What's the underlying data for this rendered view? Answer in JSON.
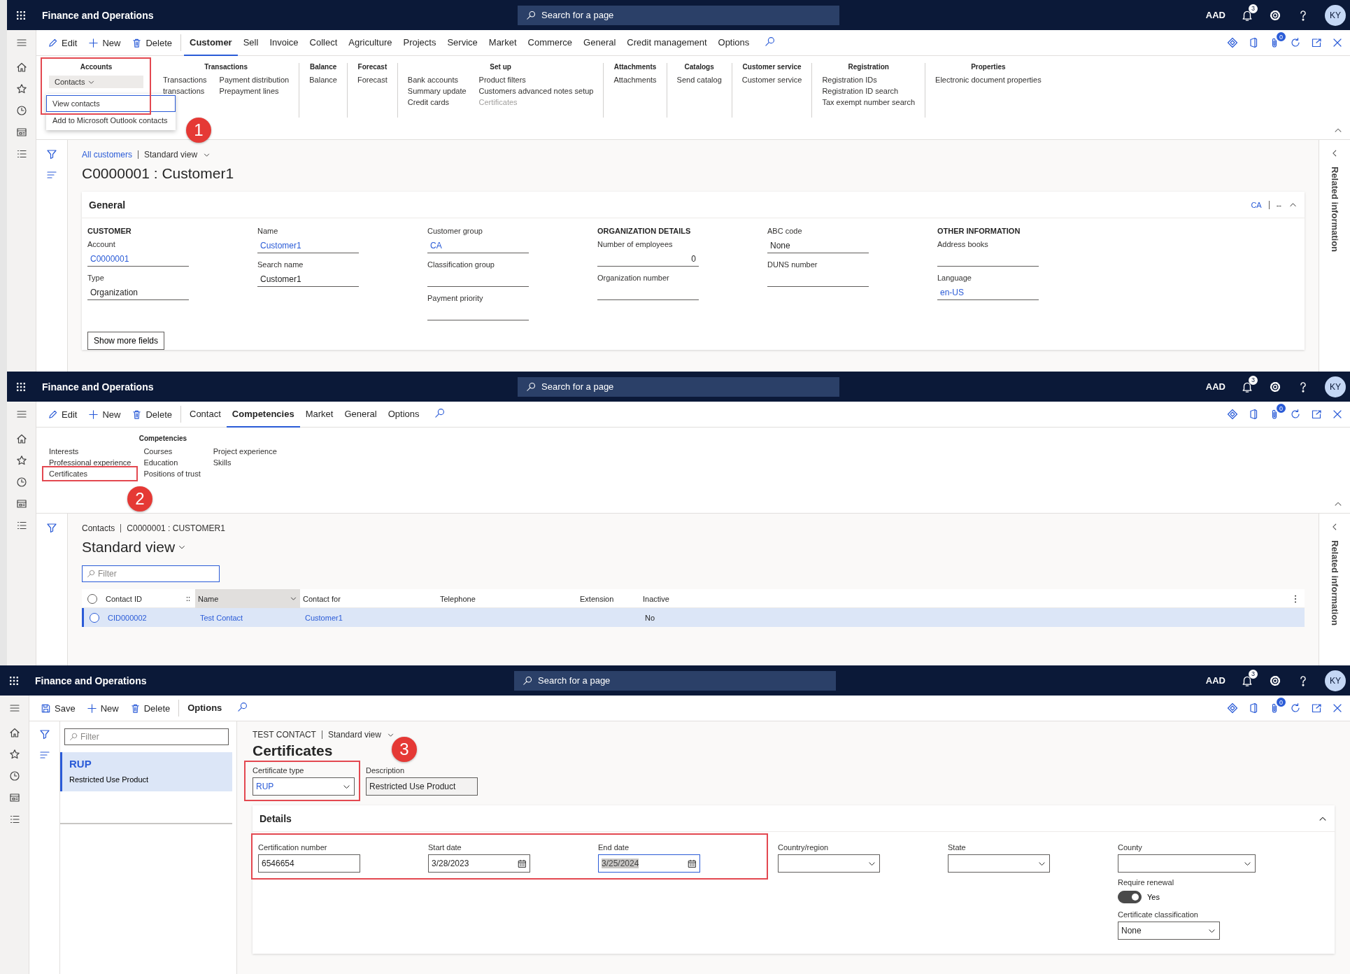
{
  "panels": [
    {
      "kind": "customer_form",
      "callout": "1",
      "header": {
        "app_title": "Finance and Operations",
        "search_placeholder": "Search for a page",
        "company": "AAD",
        "notifications": "3",
        "avatar": "KY"
      },
      "actions": [
        {
          "kind": "edit",
          "label": "Edit"
        },
        {
          "kind": "new",
          "label": "New"
        },
        {
          "kind": "delete",
          "label": "Delete"
        }
      ],
      "tabs": [
        {
          "label": "Customer",
          "selected": true
        },
        {
          "label": "Sell",
          "selected": false
        },
        {
          "label": "Invoice",
          "selected": false
        },
        {
          "label": "Collect",
          "selected": false
        },
        {
          "label": "Agriculture",
          "selected": false
        },
        {
          "label": "Projects",
          "selected": false
        },
        {
          "label": "Service",
          "selected": false
        },
        {
          "label": "Market",
          "selected": false
        },
        {
          "label": "Commerce",
          "selected": false
        },
        {
          "label": "General",
          "selected": false
        },
        {
          "label": "Credit management",
          "selected": false
        },
        {
          "label": "Options",
          "selected": false
        }
      ],
      "attachments_count": "0",
      "ribbon": [
        {
          "title": "Accounts",
          "highlighted": true,
          "dropdown": {
            "label": "Contacts",
            "expanded": true,
            "items": [
              {
                "label": "View contacts",
                "selected": true
              },
              {
                "label": "Add to Microsoft Outlook contacts",
                "selected": false
              }
            ]
          }
        },
        {
          "title": "Transactions",
          "columns": [
            [
              {
                "label": "Transactions",
                "disabled": false
              },
              {
                "label": "transactions",
                "disabled": false
              }
            ],
            [
              {
                "label": "Payment distribution",
                "disabled": false
              },
              {
                "label": "Prepayment lines",
                "disabled": false
              }
            ]
          ]
        },
        {
          "title": "Balance",
          "columns": [
            [
              {
                "label": "Balance",
                "disabled": false
              }
            ]
          ]
        },
        {
          "title": "Forecast",
          "columns": [
            [
              {
                "label": "Forecast",
                "disabled": false
              }
            ]
          ]
        },
        {
          "title": "Set up",
          "columns": [
            [
              {
                "label": "Bank accounts",
                "disabled": false
              },
              {
                "label": "Summary update",
                "disabled": false
              },
              {
                "label": "Credit cards",
                "disabled": false
              }
            ],
            [
              {
                "label": "Product filters",
                "disabled": false
              },
              {
                "label": "Customers advanced notes setup",
                "disabled": false
              },
              {
                "label": "Certificates",
                "disabled": true
              }
            ]
          ]
        },
        {
          "title": "Attachments",
          "columns": [
            [
              {
                "label": "Attachments",
                "disabled": false
              }
            ]
          ]
        },
        {
          "title": "Catalogs",
          "columns": [
            [
              {
                "label": "Send catalog",
                "disabled": false
              }
            ]
          ]
        },
        {
          "title": "Customer service",
          "columns": [
            [
              {
                "label": "Customer service",
                "disabled": false
              }
            ]
          ]
        },
        {
          "title": "Registration",
          "columns": [
            [
              {
                "label": "Registration IDs",
                "disabled": false
              },
              {
                "label": "Registration ID search",
                "disabled": false
              },
              {
                "label": "Tax exempt number search",
                "disabled": false
              }
            ]
          ]
        },
        {
          "title": "Properties",
          "columns": [
            [
              {
                "label": "Electronic document properties",
                "disabled": false
              }
            ]
          ]
        }
      ],
      "breadcrumb": [
        {
          "text": "All customers",
          "link": true
        },
        {
          "text": "Standard view",
          "link": false
        }
      ],
      "title": "C0000001 : Customer1",
      "card": {
        "title": "General",
        "header_items": [
          "CA",
          "--"
        ],
        "expanded": true,
        "columns": [
          [
            {
              "kind": "heading",
              "text": "CUSTOMER"
            },
            {
              "kind": "field",
              "label": "Account",
              "value": "C0000001",
              "link": true
            },
            {
              "kind": "field",
              "label": "Type",
              "value": "Organization",
              "link": false
            }
          ],
          [
            {
              "kind": "field",
              "label": "Name",
              "value": "Customer1",
              "link": true
            },
            {
              "kind": "field",
              "label": "Search name",
              "value": "Customer1",
              "link": false
            }
          ],
          [
            {
              "kind": "field",
              "label": "Customer group",
              "value": "CA",
              "link": true
            },
            {
              "kind": "field",
              "label": "Classification group"
            },
            {
              "kind": "field",
              "label": "Payment priority"
            }
          ],
          [
            {
              "kind": "heading",
              "text": "ORGANIZATION DETAILS"
            },
            {
              "kind": "number",
              "label": "Number of employees",
              "value": "0",
              "link": false
            },
            {
              "kind": "field",
              "label": "Organization number"
            }
          ],
          [
            {
              "kind": "field",
              "label": "ABC code",
              "value": "None",
              "link": false
            },
            {
              "kind": "field",
              "label": "DUNS number"
            }
          ],
          [
            {
              "kind": "heading",
              "text": "OTHER INFORMATION"
            },
            {
              "kind": "field",
              "label": "Address books"
            },
            {
              "kind": "field",
              "label": "Language",
              "value": "en-US",
              "link": true
            }
          ]
        ],
        "button": "Show more fields"
      },
      "related": "Related information"
    },
    {
      "kind": "contacts_list",
      "callout": "2",
      "header": {
        "app_title": "Finance and Operations",
        "search_placeholder": "Search for a page",
        "company": "AAD",
        "notifications": "3",
        "avatar": "KY"
      },
      "actions": [
        {
          "kind": "edit",
          "label": "Edit"
        },
        {
          "kind": "new",
          "label": "New"
        },
        {
          "kind": "delete",
          "label": "Delete"
        }
      ],
      "tabs": [
        {
          "label": "Contact",
          "selected": false
        },
        {
          "label": "Competencies",
          "selected": true
        },
        {
          "label": "Market",
          "selected": false
        },
        {
          "label": "General",
          "selected": false
        },
        {
          "label": "Options",
          "selected": false
        }
      ],
      "attachments_count": "0",
      "ribbon": [
        {
          "title": "Competencies",
          "columns": [
            [
              {
                "label": "Interests"
              },
              {
                "label": "Professional experience"
              },
              {
                "label": "Certificates",
                "highlighted": true
              }
            ],
            [
              {
                "label": "Courses"
              },
              {
                "label": "Education"
              },
              {
                "label": "Positions of trust"
              }
            ],
            [
              {
                "label": "Project experience"
              },
              {
                "label": "Skills"
              }
            ]
          ]
        }
      ],
      "breadcrumb": [
        {
          "text": "Contacts",
          "link": false
        },
        {
          "text": "C0000001 : CUSTOMER1",
          "link": false
        }
      ],
      "title": "Standard view",
      "filter_placeholder": "Filter",
      "grid": {
        "all_selected": false,
        "columns": [
          "Contact ID",
          "Name",
          "Contact for",
          "Telephone",
          "Extension",
          "Inactive"
        ],
        "rows": [
          {
            "selected": true,
            "cells": [
              {
                "text": "CID000002",
                "link": true
              },
              {
                "text": "Test Contact",
                "link": true
              },
              {
                "text": "Customer1",
                "link": true
              },
              {},
              {},
              {
                "text": "No",
                "link": false
              }
            ]
          }
        ]
      },
      "related": "Related information"
    },
    {
      "kind": "certificates_form",
      "callout": "3",
      "header": {
        "app_title": "Finance and Operations",
        "search_placeholder": "Search for a page",
        "company": "AAD",
        "notifications": "3",
        "avatar": "KY"
      },
      "actions": [
        {
          "kind": "save",
          "label": "Save"
        },
        {
          "kind": "new",
          "label": "New"
        },
        {
          "kind": "delete",
          "label": "Delete"
        }
      ],
      "tabs": [
        {
          "label": "Options",
          "selected": false
        }
      ],
      "attachments_count": "0",
      "filter_placeholder": "Filter",
      "list": [
        {
          "title": "RUP",
          "subtitle": "Restricted Use Product",
          "selected": true
        }
      ],
      "breadcrumb": [
        {
          "text": "TEST CONTACT",
          "link": false
        },
        {
          "text": "Standard view",
          "link": false
        }
      ],
      "title": "Certificates",
      "header_fields": [
        {
          "kind": "dropdown",
          "label": "Certificate type",
          "value": "RUP",
          "highlighted": true
        },
        {
          "kind": "readonly",
          "label": "Description",
          "value": "Restricted Use Product"
        }
      ],
      "details": {
        "title": "Details",
        "expanded": true,
        "groups": [
          {
            "highlighted": true,
            "columns": [
              [
                {
                  "kind": "text",
                  "label": "Certification number",
                  "value": "6546654"
                }
              ],
              [
                {
                  "kind": "date",
                  "label": "Start date",
                  "value": "3/28/2023",
                  "focused": false
                }
              ],
              [
                {
                  "kind": "date",
                  "label": "End date",
                  "value": "3/25/2024",
                  "focused": true
                }
              ]
            ]
          },
          {
            "columns": [
              [
                {
                  "kind": "dropdown",
                  "label": "Country/region"
                }
              ],
              [
                {
                  "kind": "dropdown",
                  "label": "State"
                }
              ],
              [
                {
                  "kind": "dropdown",
                  "label": "County"
                },
                {
                  "kind": "toggle",
                  "label": "Require renewal",
                  "on": true,
                  "value": "Yes"
                },
                {
                  "kind": "dropdown",
                  "label": "Certificate classification",
                  "value": "None"
                }
              ]
            ]
          }
        ]
      }
    }
  ]
}
